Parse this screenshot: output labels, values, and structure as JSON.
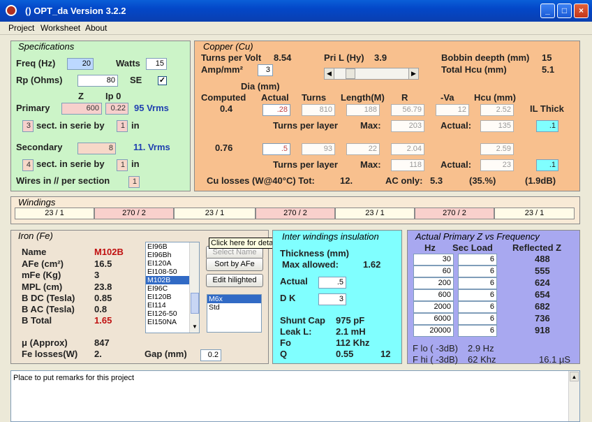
{
  "window": {
    "title": "()  OPT_da Version 3.2.2",
    "min": "_",
    "max": "□",
    "close": "×"
  },
  "menu": [
    "Project",
    "Worksheet",
    "About"
  ],
  "spec": {
    "title": "Specifications",
    "freq_label": "Freq (Hz)",
    "freq": "20",
    "watts_label": "Watts",
    "watts": "15",
    "rp_label": "Rp (Ohms)",
    "rp": "80",
    "se_label": "SE",
    "se_check": "✓",
    "z_label": "Z",
    "ip0_label": "Ip 0",
    "primary_label": "Primary",
    "primary_z": "600",
    "primary_ip0": "0.22",
    "primary_vrms": "95 Vrms",
    "pri_sect": "3",
    "sect_text": "sect. in serie by",
    "pri_by": "1",
    "in_text": "in",
    "secondary_label": "Secondary",
    "secondary_z": "8",
    "secondary_vrms": "11. Vrms",
    "sec_sect": "4",
    "sec_by": "1",
    "wires_label": "Wires in // per section",
    "wires": "1"
  },
  "copper": {
    "title": "Copper (Cu)",
    "tpv_label": "Turns per Volt",
    "tpv": "8.54",
    "amp_label": "Amp/mm²",
    "amp": "3",
    "pril_label": "Pri L (Hy)",
    "pril": "3.9",
    "bobbin_label": "Bobbin deepth (mm)",
    "bobbin": "15",
    "hcu_total_label": "Total Hcu (mm)",
    "hcu_total": "5.1",
    "dia_label": "Dia (mm)",
    "computed_label": "Computed",
    "actual_label": "Actual",
    "turns_label": "Turns",
    "length_label": "Length(M)",
    "r_label": "R",
    "va_label": "-Va",
    "hcu_label": "Hcu (mm)",
    "il_label": "IL Thick",
    "p_computed": "0.4",
    "p_actual": ".28",
    "p_turns": "810",
    "p_length": "188",
    "p_r": "56.79",
    "p_va": "12",
    "p_hcu": "2.52",
    "p_il": ".1",
    "p_max": "203",
    "p_act": "135",
    "s_computed": "0.76",
    "s_actual": ".5",
    "s_turns": "93",
    "s_length": "22",
    "s_r": "2.04",
    "s_hcu": "2.59",
    "s_il": ".1",
    "s_max": "118",
    "s_act": "23",
    "tpl_label": "Turns per layer",
    "max_label": "Max:",
    "act_label": "Actual:",
    "losses": "Cu losses (W@40°C) Tot:",
    "losses_tot": "12.",
    "ac_only": "AC only:",
    "ac_val": "5.3",
    "pct": "(35.%)",
    "db": "(1.9dB)"
  },
  "windings": {
    "title": "Windings",
    "cells": [
      "23 / 1",
      "270 / 2",
      "23 / 1",
      "270 / 2",
      "23 / 1",
      "270 / 2",
      "23 / 1"
    ]
  },
  "iron": {
    "title": "Iron (Fe)",
    "name_label": "Name",
    "name": "M102B",
    "afe_label": "AFe (cm²)",
    "afe": "16.5",
    "mfe_label": "mFe (Kg)",
    "mfe": "3",
    "mpl_label": "MPL (cm)",
    "mpl": "23.8",
    "bdc_label": "B DC (Tesla)",
    "bdc": "0.85",
    "bac_label": "B AC (Tesla)",
    "bac": "0.8",
    "btot_label": "B Total",
    "btot": "1.65",
    "mu_label": "μ (Approx)",
    "mu": "847",
    "fel_label": "Fe losses(W)",
    "fel": "2.",
    "gap_label": "Gap (mm)",
    "gap": "0.2",
    "cores": [
      "EI96B",
      "EI96Bh",
      "EI120A",
      "EI108-50",
      "M102B",
      "EI96C",
      "EI120B",
      "EI114",
      "EI126-50",
      "EI150NA"
    ],
    "btn1": "Select Name",
    "btn2": "Sort by AFe",
    "btn3": "Edit hilighted",
    "mats": [
      "M6x",
      "Std"
    ],
    "tooltip": "Click here for details"
  },
  "inter": {
    "title": "Inter windings insulation",
    "thick_label": "Thickness (mm)",
    "maxa_label": "Max allowed:",
    "maxa": "1.62",
    "actual_label": "Actual",
    "actual": ".5",
    "dk_label": "D K",
    "dk": "3",
    "shunt_label": "Shunt Cap",
    "shunt": "975 pF",
    "leak_label": "Leak L:",
    "leak": "2.1 mH",
    "fo_label": "Fo",
    "fo": "112 Khz",
    "q_label": "Q",
    "q": "0.55",
    "q2": "12"
  },
  "freq": {
    "title": "Actual Primary Z vs Frequency",
    "hz_label": "Hz",
    "sec_label": "Sec Load",
    "refl_label": "Reflected Z",
    "rows": [
      [
        "30",
        "6",
        "488"
      ],
      [
        "60",
        "6",
        "555"
      ],
      [
        "200",
        "6",
        "624"
      ],
      [
        "600",
        "6",
        "654"
      ],
      [
        "2000",
        "6",
        "682"
      ],
      [
        "6000",
        "6",
        "736"
      ],
      [
        "20000",
        "6",
        "918"
      ]
    ],
    "flo_label": "F lo  ( -3dB)",
    "flo": "2.9 Hz",
    "fhi_label": "F hi  ( -3dB)",
    "fhi": "62 Khz",
    "us": "16.1 µS"
  },
  "remarks": {
    "text": "Place to put remarks for this project"
  },
  "colors": {
    "spec": "#ccf4c8",
    "copper": "#f8c08e",
    "windings": "#f8ead6",
    "iron": "#efe4d4",
    "inter": "#80ffff",
    "freq": "#a8a8f0"
  }
}
